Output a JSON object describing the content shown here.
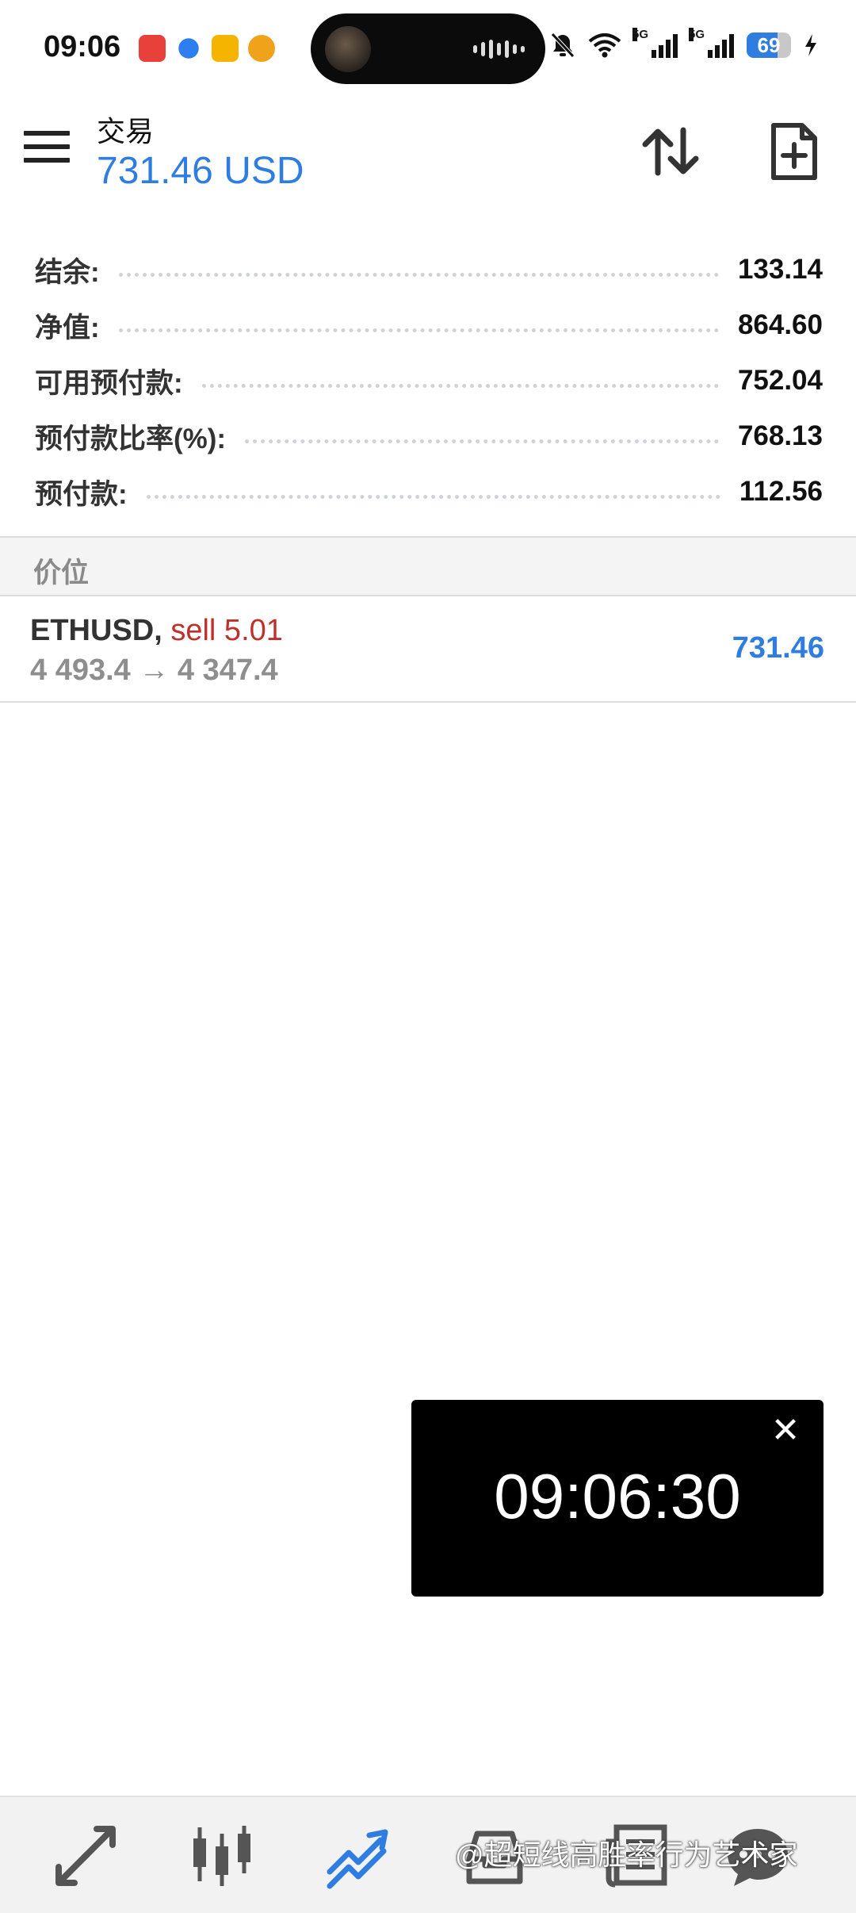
{
  "status_bar": {
    "time": "09:06",
    "battery_level": "69",
    "battery_fraction": 0.69,
    "network_tags": [
      "5G",
      "5G"
    ]
  },
  "header": {
    "title": "交易",
    "balance": "731.46 USD",
    "icons": [
      "menu-icon",
      "sort-icon",
      "new-document-icon"
    ]
  },
  "summary": [
    {
      "label": "结余:",
      "value": "133.14"
    },
    {
      "label": "净值:",
      "value": "864.60"
    },
    {
      "label": "可用预付款:",
      "value": "752.04"
    },
    {
      "label": "预付款比率(%):",
      "value": "768.13"
    },
    {
      "label": "预付款:",
      "value": "112.56"
    }
  ],
  "section": {
    "title": "价位"
  },
  "position": {
    "symbol": "ETHUSD",
    "comma": ",",
    "side": "sell 5.01",
    "prices": "4 493.4 → 4 347.4",
    "profit": "731.46"
  },
  "floating_clock": {
    "time": "09:06:30",
    "close": "✕"
  },
  "bottom_nav": {
    "items": [
      "quotes-icon",
      "chart-icon",
      "trade-icon",
      "history-icon",
      "news-icon",
      "chat-icon"
    ],
    "active": "trade-icon"
  },
  "watermark": "@超短线高胜率行为艺术家",
  "colors": {
    "accent": "#2f7de1",
    "sell": "#c0302a",
    "muted": "#8e8e8e"
  }
}
